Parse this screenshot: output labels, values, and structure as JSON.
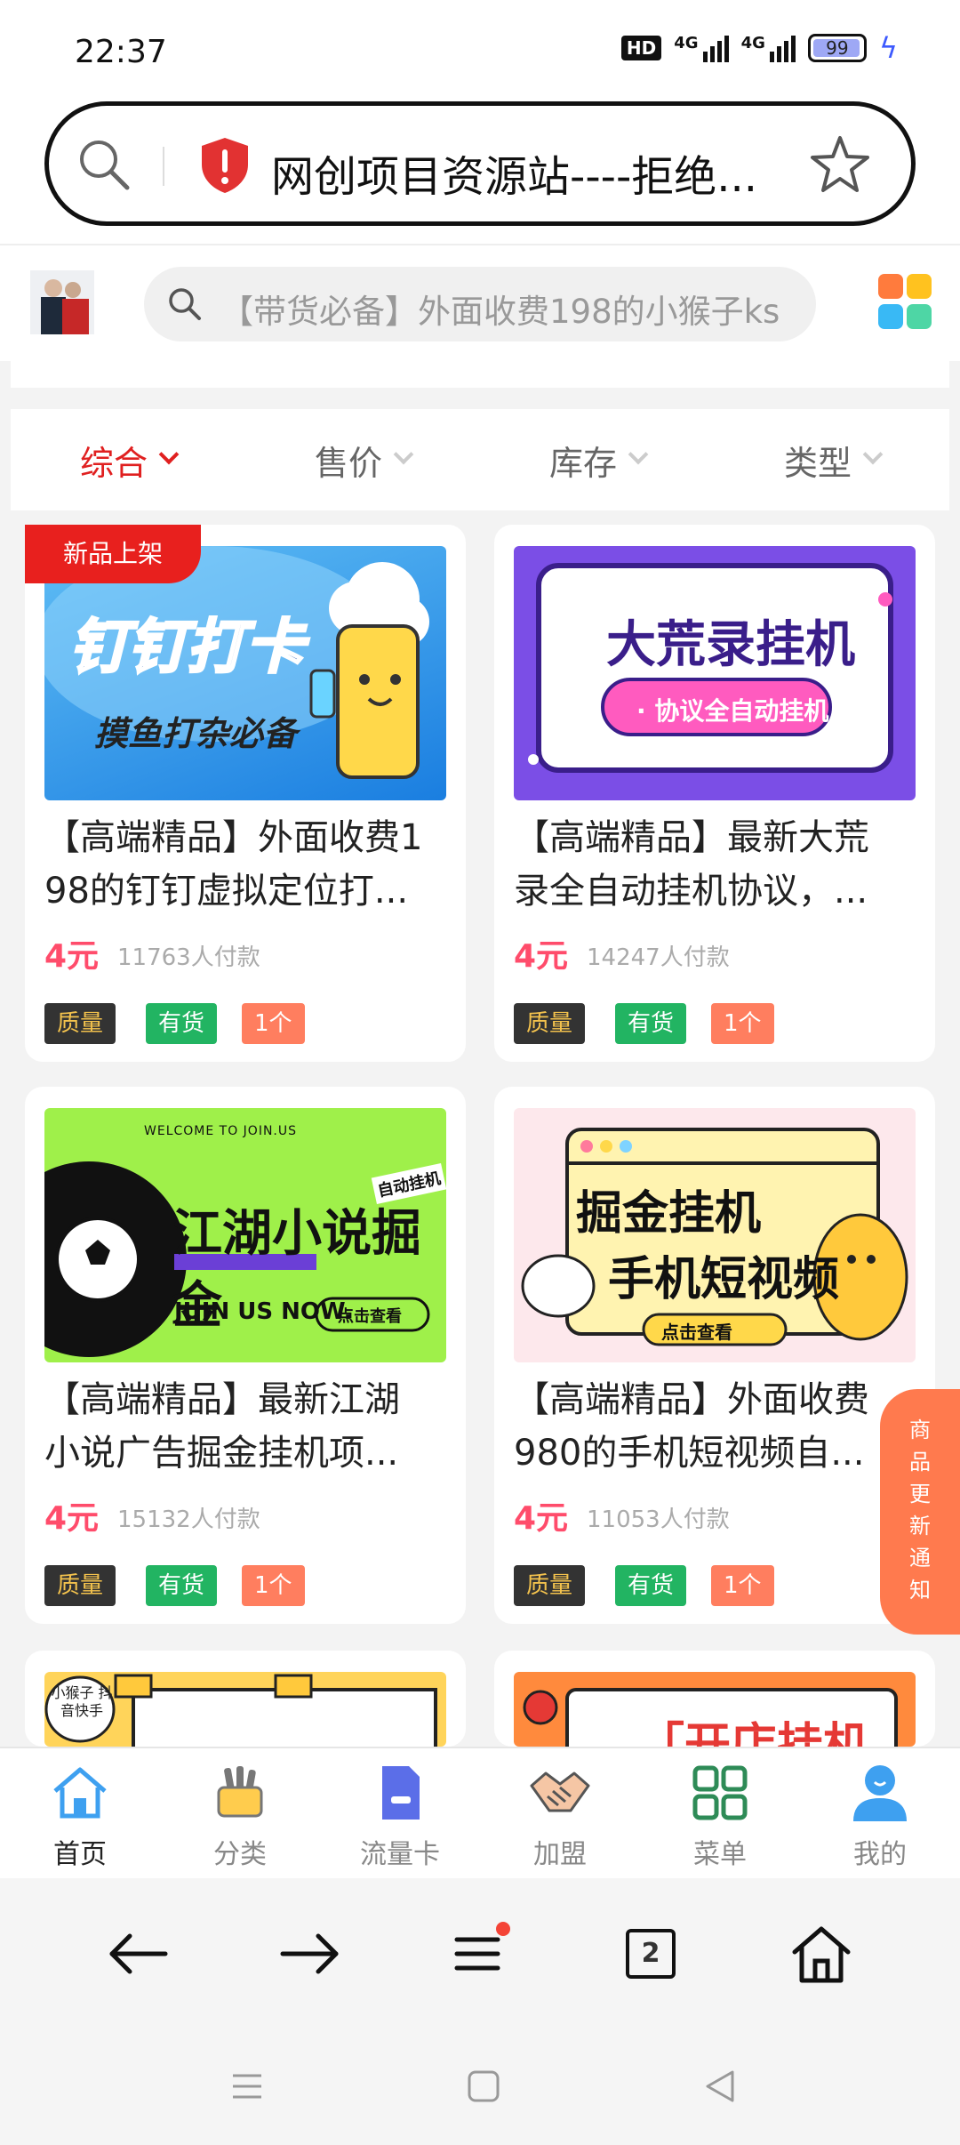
{
  "status_bar": {
    "time": "22:37",
    "hd_label": "HD",
    "signal_1": "4G",
    "signal_2": "4G",
    "battery": "99"
  },
  "browser": {
    "url_title": "网创项目资源站----拒绝...",
    "tab_count": "2"
  },
  "site": {
    "search_placeholder": "【带货必备】外面收费198的小猴子ks"
  },
  "sort_bar": [
    {
      "label": "综合",
      "active": true
    },
    {
      "label": "售价",
      "active": false
    },
    {
      "label": "库存",
      "active": false
    },
    {
      "label": "类型",
      "active": false
    }
  ],
  "products": [
    {
      "badge": "新品上架",
      "title_line1": "【高端精品】外面收费1",
      "title_line2": "98的钉钉虚拟定位打...",
      "price": "4元",
      "sales": "11763人付款",
      "image_title": "钉钉打卡",
      "image_subtitle": "摸鱼打杂必备",
      "tags": [
        "质量",
        "有货",
        "1个"
      ]
    },
    {
      "title_line1": "【高端精品】最新大荒",
      "title_line2": "录全自动挂机协议，...",
      "price": "4元",
      "sales": "14247人付款",
      "image_title": "大荒录挂机",
      "image_subtitle": "· 协议全自动挂机 ·",
      "tags": [
        "质量",
        "有货",
        "1个"
      ]
    },
    {
      "title_line1": "【高端精品】最新江湖",
      "title_line2": "小说广告掘金挂机项...",
      "price": "4元",
      "sales": "15132人付款",
      "image_title": "江湖小说掘金",
      "image_subtitle": "JUIN US NOW.",
      "image_top": "WELCOME TO JOIN.US",
      "image_tag": "自动挂机",
      "image_button": "点击查看",
      "tags": [
        "质量",
        "有货",
        "1个"
      ]
    },
    {
      "title_line1": "【高端精品】外面收费",
      "title_line2": "980的手机短视频自...",
      "price": "4元",
      "sales": "11053人付款",
      "image_title": "掘金挂机",
      "image_subtitle": "手机短视频",
      "image_button": "点击查看",
      "tags": [
        "质量",
        "有货",
        "1个"
      ]
    }
  ],
  "partial_cards": {
    "left_text": "小猴子 抖音快手",
    "right_text": "「开店挂机"
  },
  "float_notice": [
    "商",
    "品",
    "更",
    "新",
    "通",
    "知"
  ],
  "tab_bar": [
    {
      "label": "首页",
      "icon": "home-icon",
      "active": true
    },
    {
      "label": "分类",
      "icon": "category-icon",
      "active": false
    },
    {
      "label": "流量卡",
      "icon": "sim-card-icon",
      "active": false
    },
    {
      "label": "加盟",
      "icon": "handshake-icon",
      "active": false
    },
    {
      "label": "菜单",
      "icon": "menu-grid-icon",
      "active": false
    },
    {
      "label": "我的",
      "icon": "user-icon",
      "active": false
    }
  ],
  "colors": {
    "accent_red": "#e02020",
    "price_pink": "#ff4c6b",
    "tag_green": "#22b462",
    "tag_orange": "#ff7e5f",
    "notice_orange": "#ff7a4e",
    "tab_blue": "#3ea0f0"
  }
}
